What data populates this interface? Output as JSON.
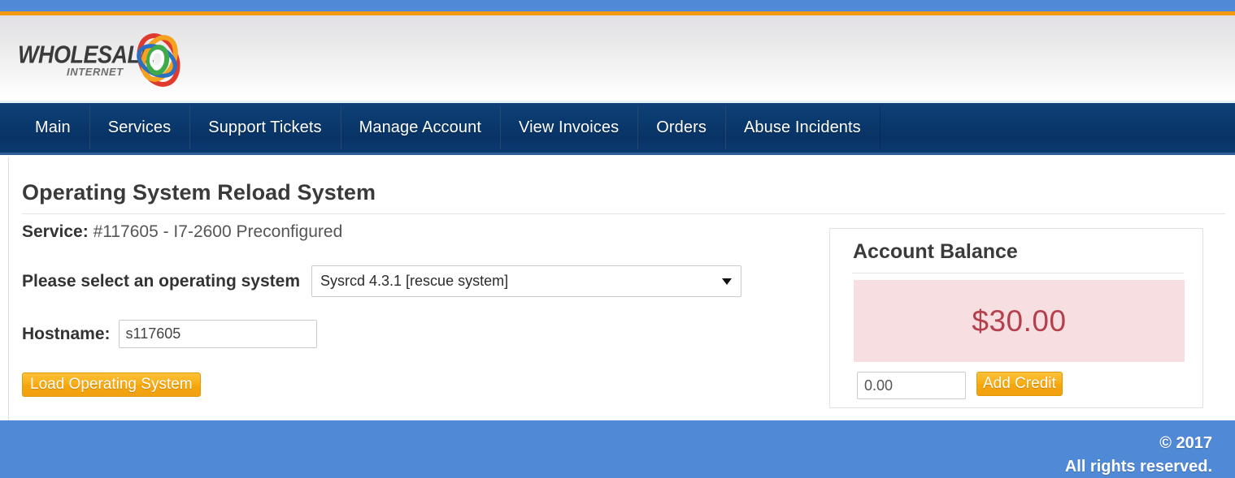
{
  "branding": {
    "logo_wordmark": "WHOLESALE",
    "logo_sub": "INTERNET",
    "top_bar_color": "#5089d5",
    "accent_orange": "#f2990d",
    "nav_color": "#0a3a6e"
  },
  "nav": {
    "items": [
      {
        "label": "Main"
      },
      {
        "label": "Services"
      },
      {
        "label": "Support Tickets"
      },
      {
        "label": "Manage Account"
      },
      {
        "label": "View Invoices"
      },
      {
        "label": "Orders"
      },
      {
        "label": "Abuse Incidents"
      }
    ]
  },
  "main": {
    "page_title": "Operating System Reload System",
    "service_label": "Service:",
    "service_value": "#117605 - I7-2600 Preconfigured",
    "os_label": "Please select an operating system",
    "os_selected": "Sysrcd 4.3.1 [rescue system]",
    "os_options": [
      "Sysrcd 4.3.1 [rescue system]"
    ],
    "hostname_label": "Hostname:",
    "hostname_value": "s117605",
    "hostname_placeholder": "s117605",
    "load_button": "Load Operating System"
  },
  "balance": {
    "title": "Account Balance",
    "amount": "$30.00",
    "amount_color": "#b4404e",
    "amount_bg": "#f7dfe1",
    "credit_value": "0.00",
    "credit_placeholder": "0.00",
    "add_credit_button": "Add Credit"
  },
  "footer": {
    "copyright": "© 2017",
    "rights": "All rights reserved."
  }
}
